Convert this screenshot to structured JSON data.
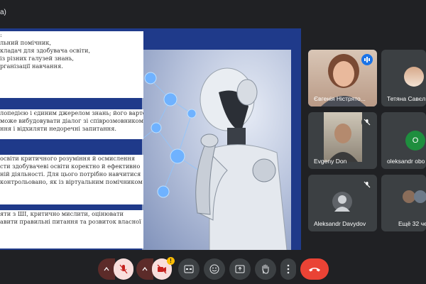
{
  "topbar": {
    "title": "а)"
  },
  "slide": {
    "panel1": [
      "  :",
      "льний помічник,",
      "",
      "кладач для здобувача освіти,",
      "",
      "із різних галузей знань,",
      "рганізації навчання."
    ],
    "panel2": [
      "лопедією і єдиним джерелом знань; його варто",
      "може вибудовувати діалог зі співрозмовником,",
      "ння і відхиляти недоречні запитання."
    ],
    "panel3": [
      "освіти  критичного  розуміння  й  осмислення",
      "сти  здобувачеві  освіти  коректно  й  ефективно",
      "ній  діяльності.  Для  цього  потрібно  навчитися",
      "  контрольовано,  як  із  віртуальним  помічником"
    ],
    "panel4": [
      "яти  з  ШІ,    критично  мислити,  оцінювати",
      "авити  правильні  питання  та  розвиток  власної"
    ]
  },
  "participants": [
    {
      "name": "Євгенія Ністрято...",
      "active": true,
      "mic": "speaking"
    },
    {
      "name": "Тетяна Савєл",
      "mic": "none"
    },
    {
      "name": "Evgeny Don",
      "mic": "muted"
    },
    {
      "name": "oleksandr obo",
      "initial": "O",
      "avatar_color": "#1e8e3e",
      "mic": "none"
    },
    {
      "name": "Aleksandr Davydov",
      "mic": "muted"
    },
    {
      "name": "Ещё 32 че"
    }
  ],
  "controls": {
    "mic": "mic-off-icon",
    "camera": "camera-off-icon",
    "captions": "captions-icon",
    "emoji": "emoji-icon",
    "present": "present-icon",
    "hand": "raise-hand-icon",
    "more": "more-vert-icon",
    "end": "end-call-icon",
    "warning_badge": "!",
    "colors": {
      "danger": "#ea4335",
      "dark": "#3c4043",
      "muted_bg": "#f9dedc"
    }
  }
}
